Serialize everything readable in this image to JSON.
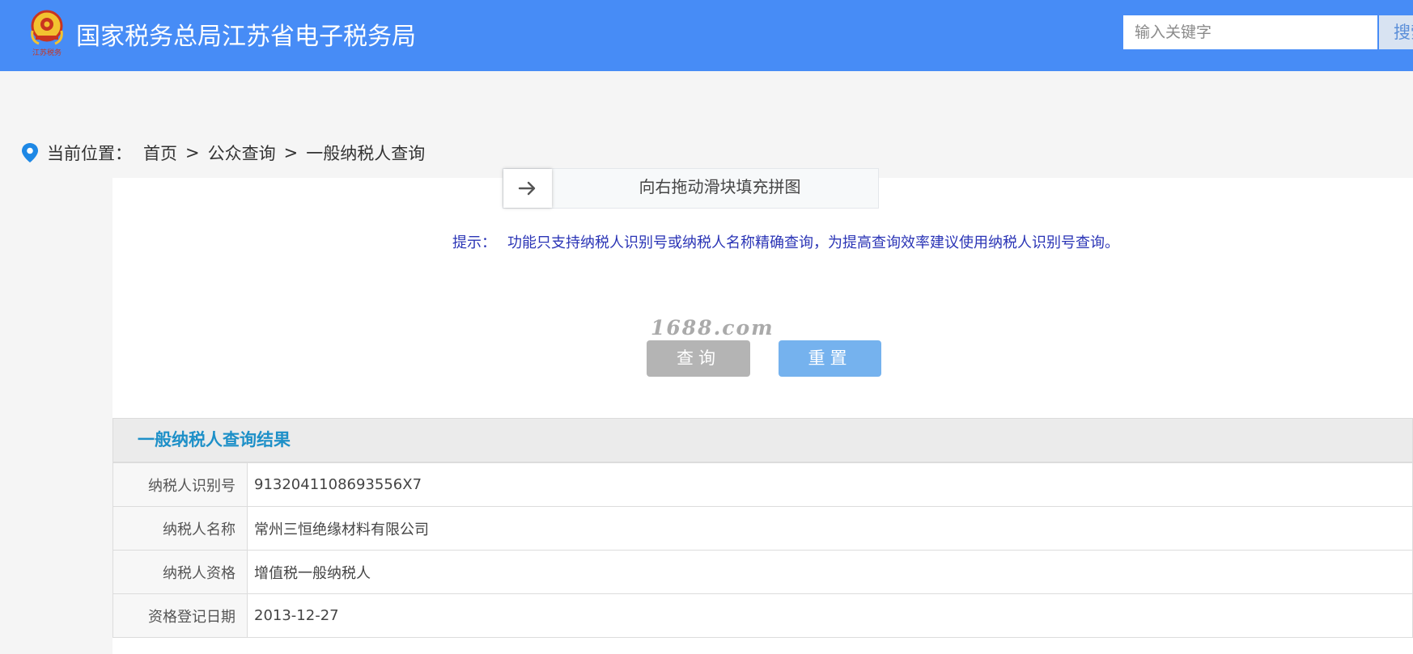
{
  "header": {
    "logo_text": "江苏税务",
    "title": "国家税务总局江苏省电子税务局",
    "search_placeholder": "输入关键字",
    "search_button_label": "搜索"
  },
  "breadcrumb": {
    "label": "当前位置：",
    "items": [
      "首页",
      "公众查询",
      "一般纳税人查询"
    ],
    "separator": ">"
  },
  "slider": {
    "handle_icon": "arrow-right-icon",
    "text": "向右拖动滑块填充拼图"
  },
  "hint": {
    "label": "提示：",
    "text": "功能只支持纳税人识别号或纳税人名称精确查询，为提高查询效率建议使用纳税人识别号查询。"
  },
  "watermark": "1688.com",
  "buttons": {
    "query": "查询",
    "reset": "重置"
  },
  "result": {
    "title": "一般纳税人查询结果",
    "rows": [
      {
        "label": "纳税人识别号",
        "value": "9132041108693556X7"
      },
      {
        "label": "纳税人名称",
        "value": "常州三恒绝缘材料有限公司"
      },
      {
        "label": "纳税人资格",
        "value": "增值税一般纳税人"
      },
      {
        "label": "资格登记日期",
        "value": "2013-12-27"
      }
    ]
  },
  "colors": {
    "header_bg": "#478cf6",
    "hint_text": "#2b35b6",
    "result_title": "#1e90c8",
    "query_button": "#b4b4b4",
    "reset_button": "#75b2ee"
  }
}
